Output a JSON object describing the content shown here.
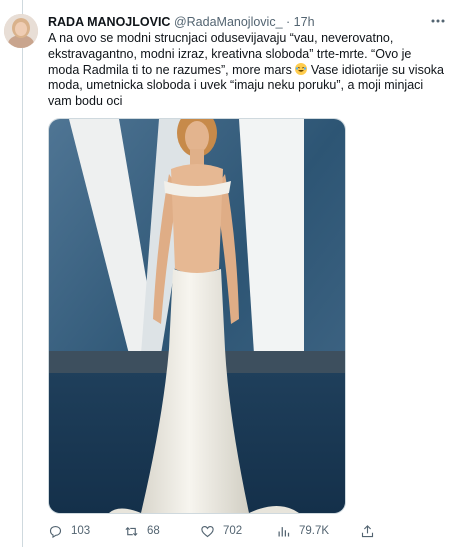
{
  "tweet": {
    "author_name": "RADA MANOJLOVIC",
    "author_handle": "@RadaManojlovic_",
    "separator": "·",
    "time": "17h",
    "text_before_emoji": "A na ovo se modni strucnjaci odusevijavaju “vau, neverovatno, ekstravagantno, modni izraz, kreativna sloboda” trte-mrte. “Ovo je moda Radmila ti to ne razumes”, more mars",
    "text_after_emoji": "Vase idiotarije su visoka moda, umetnicka sloboda i uvek “imaju neku poruku”, a moji minjaci vam bodu oci"
  },
  "actions": {
    "replies": "103",
    "retweets": "68",
    "likes": "702",
    "views": "79.7K"
  },
  "icons": {
    "reply": "reply-icon",
    "retweet": "retweet-icon",
    "like": "heart-icon",
    "views": "views-icon",
    "share": "share-icon",
    "more": "more-icon",
    "emoji": "laughing-emoji-icon"
  },
  "colors": {
    "text": "#0f1419",
    "secondary": "#536471",
    "border": "#cfd9de",
    "backdrop_blue": "#2f5876",
    "dress": "#f3f1ea"
  }
}
